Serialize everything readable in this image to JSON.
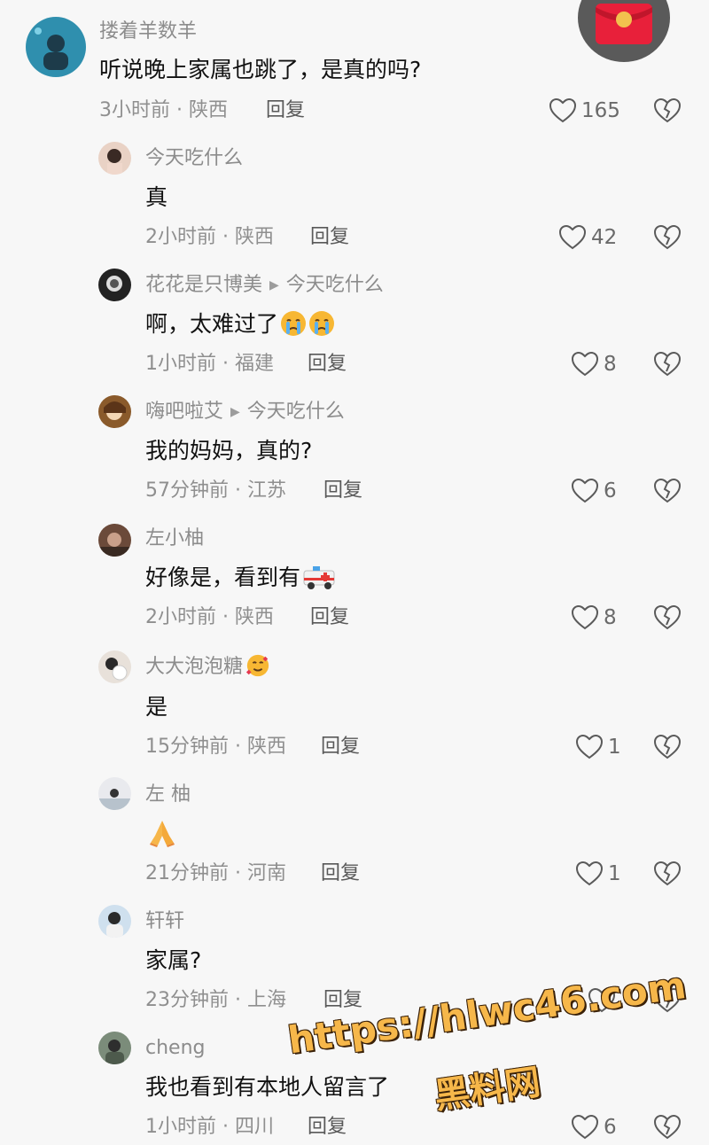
{
  "comments": [
    {
      "user": "搂着羊数羊",
      "text": "听说晚上家属也跳了，是真的吗?",
      "time": "3小时前",
      "region": "陕西",
      "reply": "回复",
      "likes": "165"
    },
    {
      "user": "今天吃什么",
      "text": "真",
      "time": "2小时前",
      "region": "陕西",
      "reply": "回复",
      "likes": "42"
    },
    {
      "user": "花花是只博美",
      "reply_to": "今天吃什么",
      "text": "啊，太难过了",
      "time": "1小时前",
      "region": "福建",
      "reply": "回复",
      "likes": "8"
    },
    {
      "user": "嗨吧啦艾",
      "reply_to": "今天吃什么",
      "text": "我的妈妈，真的?",
      "time": "57分钟前",
      "region": "江苏",
      "reply": "回复",
      "likes": "6"
    },
    {
      "user": "左小柚",
      "text": "好像是，看到有",
      "time": "2小时前",
      "region": "陕西",
      "reply": "回复",
      "likes": "8"
    },
    {
      "user": "大大泡泡糖",
      "text": "是",
      "time": "15分钟前",
      "region": "陕西",
      "reply": "回复",
      "likes": "1"
    },
    {
      "user": "左 柚",
      "text": "",
      "time": "21分钟前",
      "region": "河南",
      "reply": "回复",
      "likes": "1"
    },
    {
      "user": "轩轩",
      "text": "家属?",
      "time": "23分钟前",
      "region": "上海",
      "reply": "回复",
      "likes": ""
    },
    {
      "user": "cheng",
      "text": "我也看到有本地人留言了",
      "time": "1小时前",
      "region": "四川",
      "reply": "回复",
      "likes": "6"
    }
  ],
  "watermark": {
    "line1": "https://hlwc46.com",
    "line2": "黑料网"
  },
  "icons": {
    "like": "heart-outline-icon",
    "dislike": "broken-heart-icon",
    "reply_arrow": "triangle-right-icon"
  },
  "colors": {
    "background": "#f7f7f7",
    "meta": "#8f8f8f",
    "watermark": "#f6b74a"
  }
}
